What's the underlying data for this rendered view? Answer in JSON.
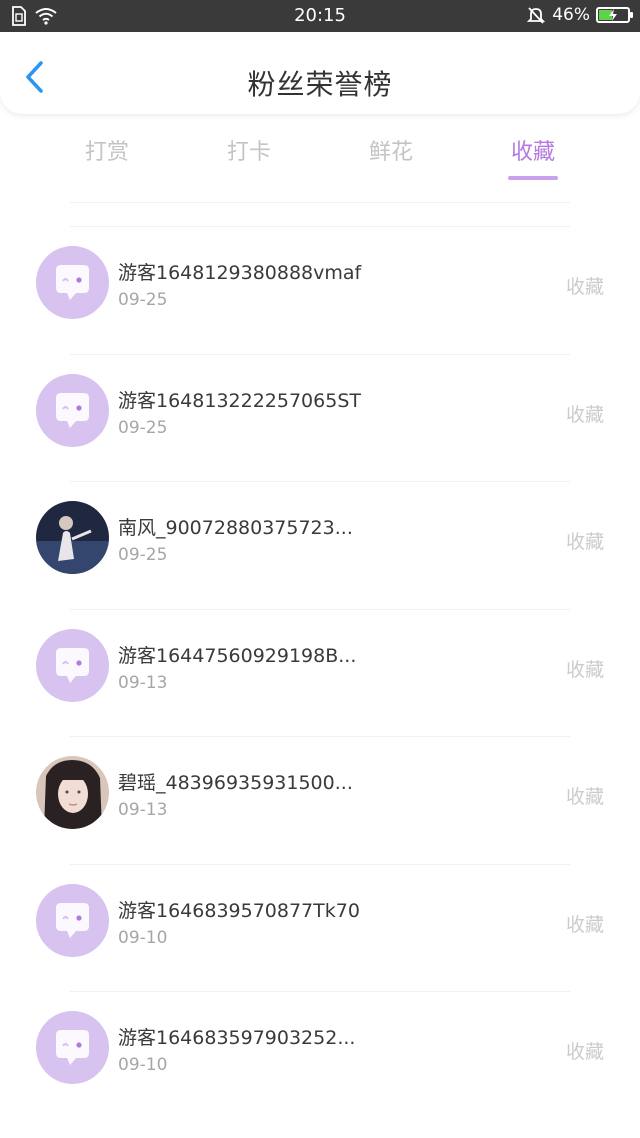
{
  "status_bar": {
    "time": "20:15",
    "battery": "46%",
    "battery_level": 0.46,
    "icons": [
      "sim-icon",
      "wifi-icon",
      "bell-muted-icon",
      "battery-icon"
    ]
  },
  "header": {
    "title": "粉丝荣誉榜",
    "back_icon": "chevron-left-icon"
  },
  "colors": {
    "accent": "#b47ae0",
    "tab_inactive": "#c4c4c4",
    "avatar_default_bg": "#d7c2f0",
    "back_arrow": "#2b95f3"
  },
  "tabs": [
    {
      "label": "打赏",
      "active": false
    },
    {
      "label": "打卡",
      "active": false
    },
    {
      "label": "鲜花",
      "active": false
    },
    {
      "label": "收藏",
      "active": true
    }
  ],
  "list": [
    {
      "name": "游客1648129380888vmaf",
      "date": "09-25",
      "action": "收藏",
      "avatar": "default-avatar"
    },
    {
      "name": "游客164813222257065ST",
      "date": "09-25",
      "action": "收藏",
      "avatar": "default-avatar"
    },
    {
      "name": "南风_90072880375723...",
      "date": "09-25",
      "action": "收藏",
      "avatar": "photo-avatar-dark"
    },
    {
      "name": "游客16447560929198B...",
      "date": "09-13",
      "action": "收藏",
      "avatar": "default-avatar"
    },
    {
      "name": "碧瑶_48396935931500...",
      "date": "09-13",
      "action": "收藏",
      "avatar": "photo-avatar-light"
    },
    {
      "name": "游客1646839570877Tk70",
      "date": "09-10",
      "action": "收藏",
      "avatar": "default-avatar"
    },
    {
      "name": "游客164683597903252...",
      "date": "09-10",
      "action": "收藏",
      "avatar": "default-avatar"
    }
  ]
}
